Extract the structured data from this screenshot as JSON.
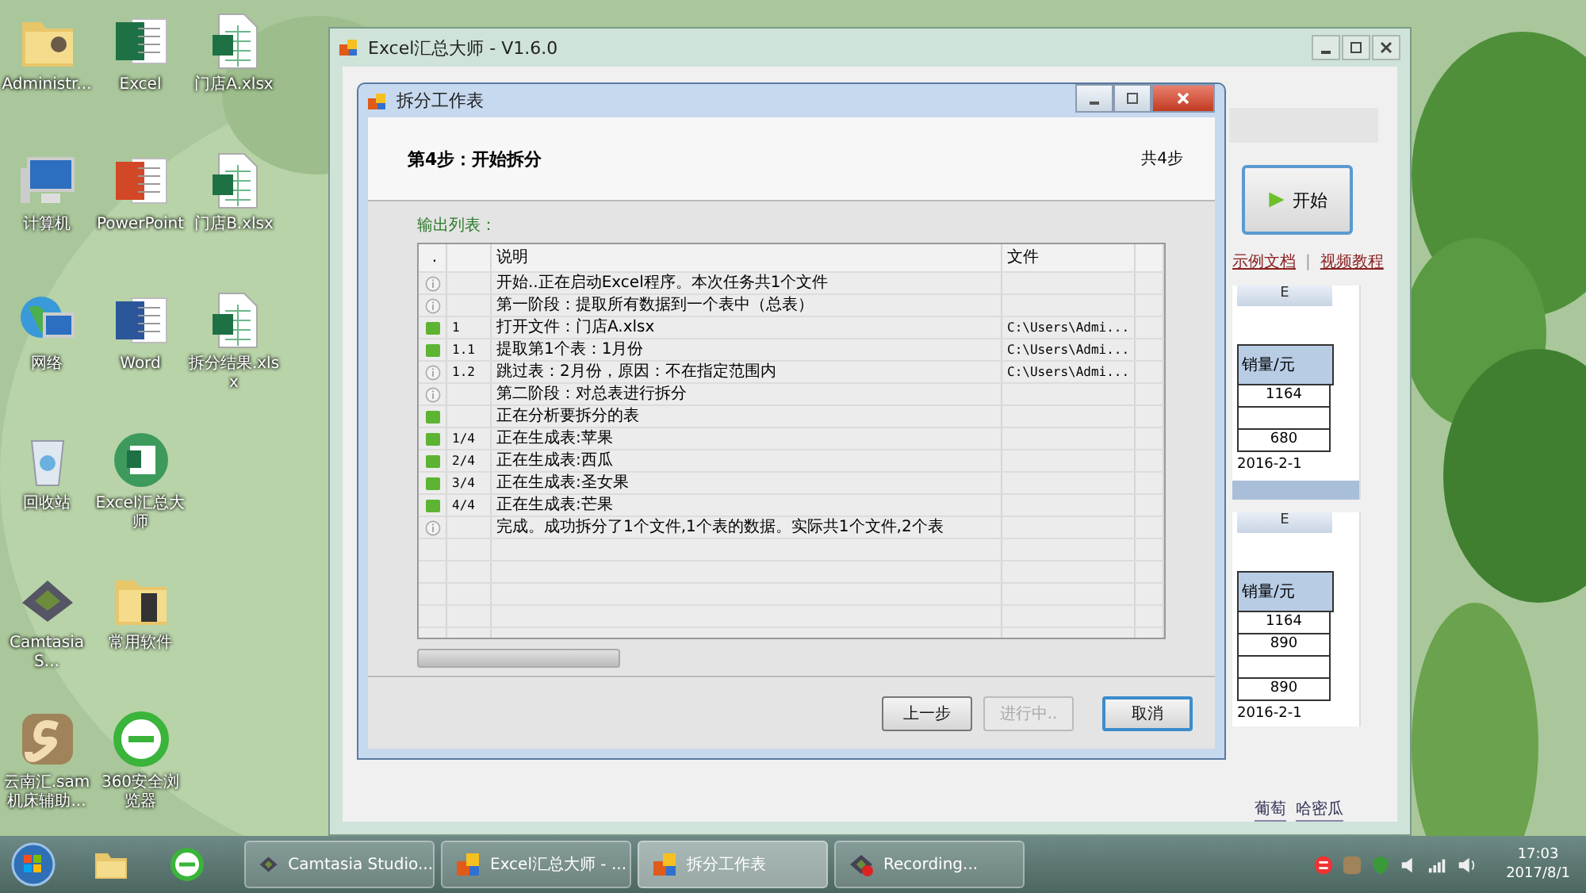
{
  "desktop": {
    "columns": [
      [
        {
          "label": "Administr...",
          "kind": "user-folder"
        },
        {
          "label": "计算机",
          "kind": "computer"
        },
        {
          "label": "网络",
          "kind": "network"
        },
        {
          "label": "回收站",
          "kind": "recycle"
        },
        {
          "label": "CamtasiaS...",
          "kind": "camtasia"
        },
        {
          "label": "云南汇.sam机床辅助...",
          "kind": "s-app"
        }
      ],
      [
        {
          "label": "Excel",
          "kind": "excel"
        },
        {
          "label": "PowerPoint",
          "kind": "powerpoint"
        },
        {
          "label": "Word",
          "kind": "word"
        },
        {
          "label": "Excel汇总大师",
          "kind": "excel-round"
        },
        {
          "label": "常用软件",
          "kind": "folder"
        },
        {
          "label": "360安全浏览器",
          "kind": "browser"
        }
      ],
      [
        {
          "label": "门店A.xlsx",
          "kind": "xlsx"
        },
        {
          "label": "门店B.xlsx",
          "kind": "xlsx"
        },
        {
          "label": "拆分结果.xlsx",
          "kind": "xlsx"
        }
      ]
    ]
  },
  "main_window": {
    "title": "Excel汇总大师 - V1.6.0",
    "start_button": "开始",
    "links": [
      "示例文档",
      "视频教程"
    ],
    "links_separator": "|",
    "sheets": [
      {
        "column": "E",
        "header": "销量/元",
        "values": [
          {
            "kind": "text",
            "text": "1164"
          },
          {
            "kind": "blank"
          },
          {
            "kind": "text",
            "text": "680"
          }
        ],
        "date": "2016-2-1"
      },
      {
        "column": "E",
        "header": "销量/元",
        "values": [
          {
            "kind": "text",
            "text": "1164"
          },
          {
            "kind": "text",
            "text": "890"
          },
          {
            "kind": "blank"
          },
          {
            "kind": "text",
            "text": "890"
          }
        ],
        "date": "2016-2-1"
      }
    ],
    "sheet_tabs": [
      "葡萄",
      "哈密瓜"
    ]
  },
  "dialog": {
    "title": "拆分工作表",
    "step_title": "第4步：开始拆分",
    "step_count": "共4步",
    "list_label": "输出列表：",
    "columns": [
      ".",
      "说明",
      "文件"
    ],
    "rows": [
      {
        "kind": "info",
        "text": "开始..正在启动Excel程序。本次任务共1个文件"
      },
      {
        "kind": "info",
        "text": "第一阶段：提取所有数据到一个表中（总表）"
      },
      {
        "kind": "ok",
        "number": "1",
        "text": "打开文件：门店A.xlsx",
        "file": "C:\\Users\\Admi..."
      },
      {
        "kind": "ok",
        "number": "1.1",
        "text": "提取第1个表：1月份",
        "file": "C:\\Users\\Admi..."
      },
      {
        "kind": "info",
        "number": "1.2",
        "text": "跳过表：2月份，原因：不在指定范围内",
        "file": "C:\\Users\\Admi..."
      },
      {
        "kind": "info",
        "text": "第二阶段：对总表进行拆分"
      },
      {
        "kind": "ok",
        "text": "正在分析要拆分的表"
      },
      {
        "kind": "ok",
        "number": "1/4",
        "text": "正在生成表:苹果"
      },
      {
        "kind": "ok",
        "number": "2/4",
        "text": "正在生成表:西瓜"
      },
      {
        "kind": "ok",
        "number": "3/4",
        "text": "正在生成表:圣女果"
      },
      {
        "kind": "ok",
        "number": "4/4",
        "text": "正在生成表:芒果"
      },
      {
        "kind": "info",
        "text": "完成。成功拆分了1个文件,1个表的数据。实际共1个文件,2个表"
      }
    ],
    "progress": {
      "level": 0
    },
    "buttons": [
      {
        "label": "上一步",
        "disabled": false,
        "default": false
      },
      {
        "label": "进行中..",
        "disabled": true,
        "default": false
      },
      {
        "label": "取消",
        "disabled": false,
        "default": true
      }
    ]
  },
  "taskbar": {
    "tasks": [
      {
        "label": "Camtasia Studio...",
        "kind": "camtasia",
        "selected": false
      },
      {
        "label": "Excel汇总大师 - ...",
        "kind": "app",
        "selected": false
      },
      {
        "label": "拆分工作表",
        "kind": "app",
        "selected": true
      },
      {
        "label": "Recording...",
        "kind": "recording",
        "selected": false
      }
    ],
    "clock": {
      "time": "17:03",
      "date": "2017/8/1"
    }
  }
}
